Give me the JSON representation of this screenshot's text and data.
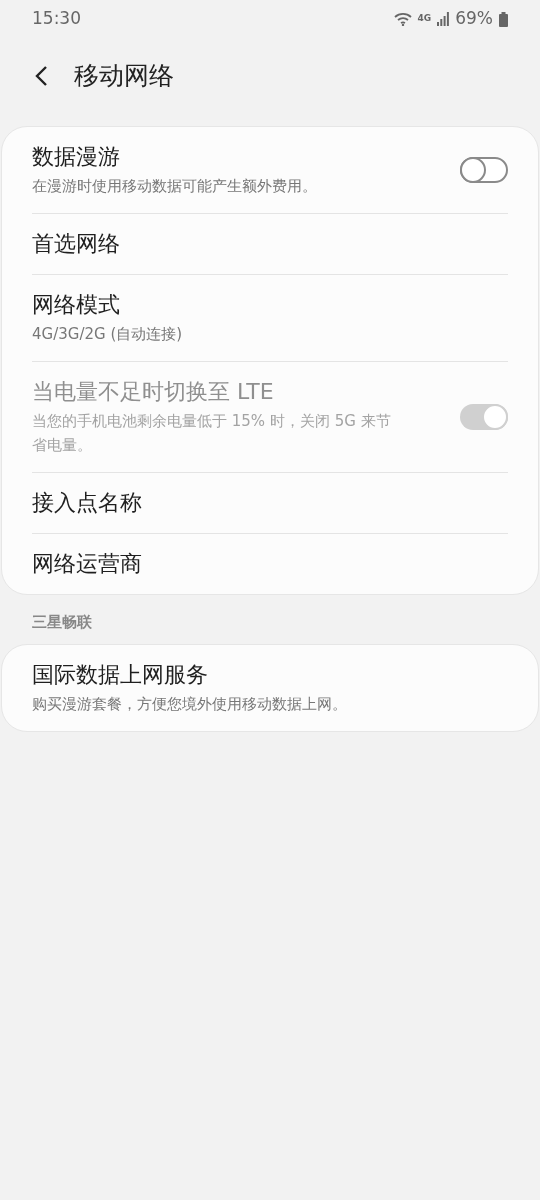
{
  "status_bar": {
    "time": "15:30",
    "network": "4G",
    "battery": "69%"
  },
  "header": {
    "title": "移动网络"
  },
  "groups": [
    {
      "items": [
        {
          "kind": "toggle",
          "title": "数据漫游",
          "subtitle": "在漫游时使用移动数据可能产生额外费用。",
          "on": false,
          "disabled": false
        },
        {
          "kind": "link",
          "title": "首选网络",
          "disabled": false
        },
        {
          "kind": "link",
          "title": "网络模式",
          "subtitle": "4G/3G/2G (自动连接)",
          "disabled": false
        },
        {
          "kind": "toggle",
          "title": "当电量不足时切换至 LTE",
          "subtitle": "当您的手机电池剩余电量低于 15% 时，关闭 5G 来节省电量。",
          "on": true,
          "disabled": true
        },
        {
          "kind": "link",
          "title": "接入点名称",
          "disabled": false
        },
        {
          "kind": "link",
          "title": "网络运营商",
          "disabled": false
        }
      ]
    },
    {
      "header": "三星畅联",
      "items": [
        {
          "kind": "link",
          "title": "国际数据上网服务",
          "subtitle": "购买漫游套餐，方便您境外使用移动数据上网。",
          "disabled": false
        }
      ]
    }
  ]
}
